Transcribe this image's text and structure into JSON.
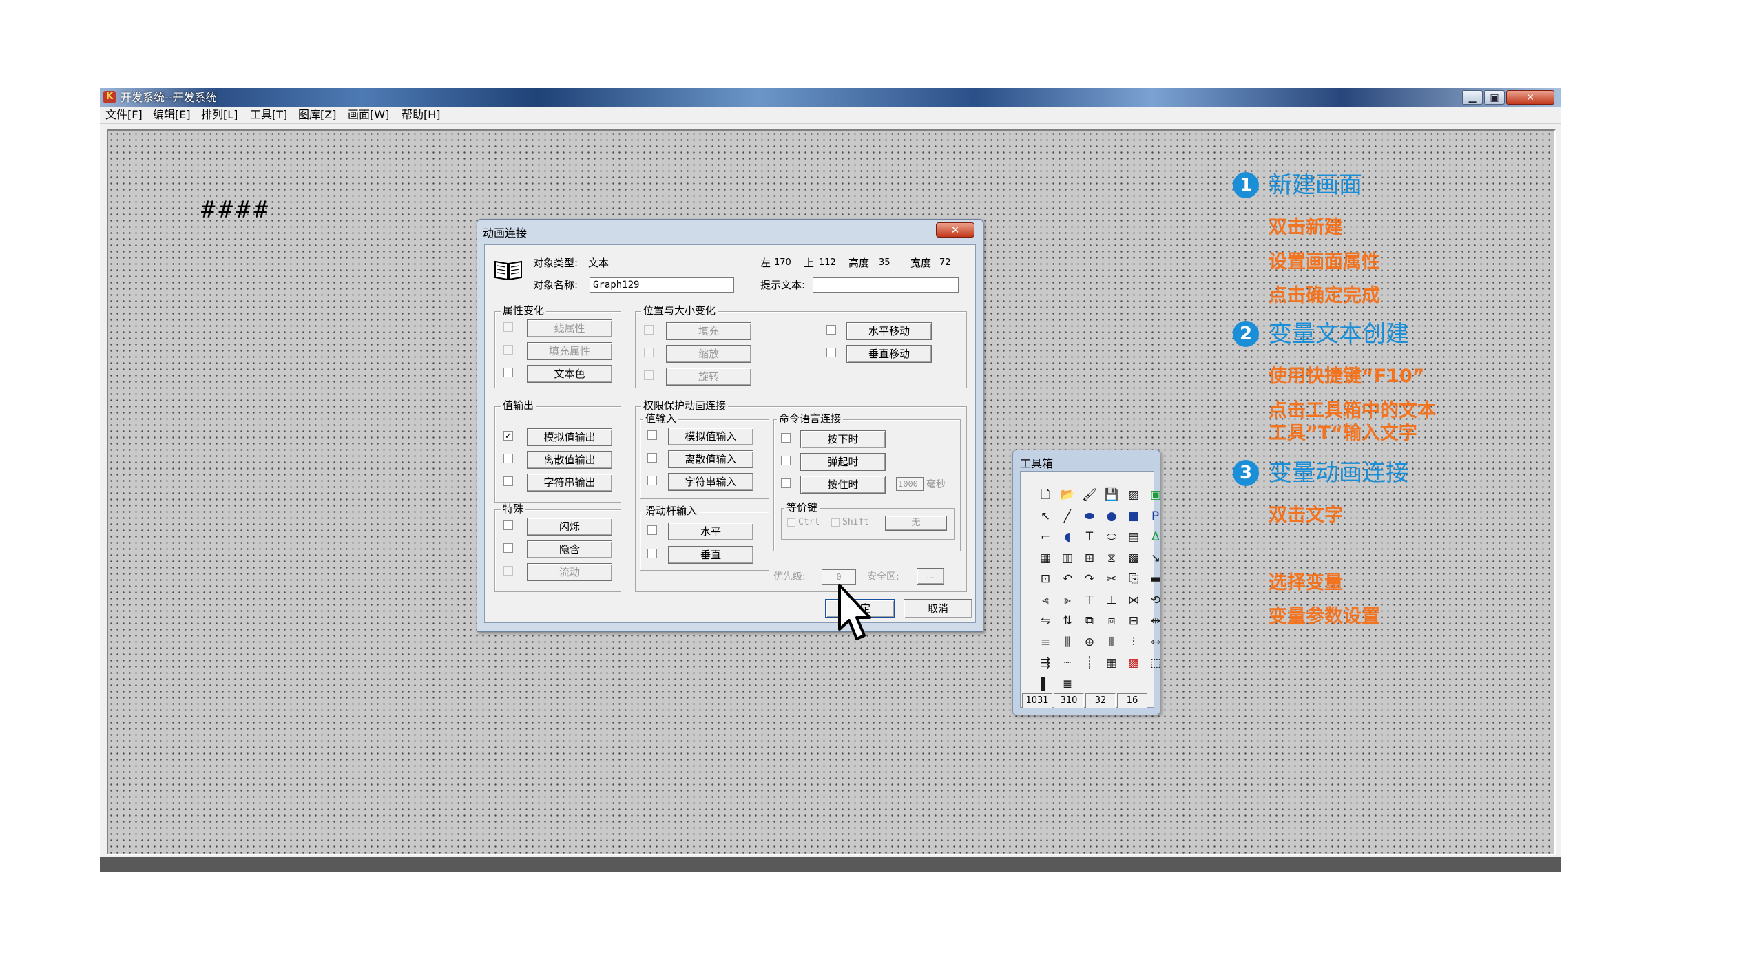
{
  "window": {
    "title": "开发系统--开发系统",
    "minimize": "▁",
    "maximize": "▣",
    "close": "✕"
  },
  "menu": [
    "文件[F]",
    "编辑[E]",
    "排列[L]",
    "工具[T]",
    "图库[Z]",
    "画面[W]",
    "帮助[H]"
  ],
  "canvas": {
    "text": "####"
  },
  "dialog": {
    "title": "动画连接",
    "close": "✕",
    "object_type_label": "对象类型:",
    "object_type_value": "文本",
    "left_label": "左",
    "left_value": "170",
    "top_label": "上",
    "top_value": "112",
    "height_label": "高度",
    "height_value": "35",
    "width_label": "宽度",
    "width_value": "72",
    "object_name_label": "对象名称:",
    "object_name_value": "Graph129",
    "hint_label": "提示文本:",
    "hint_value": "",
    "attr_group": {
      "title": "属性变化",
      "items": [
        "线属性",
        "填充属性",
        "文本色"
      ]
    },
    "pos_group": {
      "title": "位置与大小变化",
      "items": [
        "填充",
        "缩放",
        "旋转"
      ],
      "moves": [
        "水平移动",
        "垂直移动"
      ]
    },
    "value_out_group": {
      "title": "值输出",
      "items": [
        "模拟值输出",
        "离散值输出",
        "字符串输出"
      ],
      "checked": "✓"
    },
    "special_group": {
      "title": "特殊",
      "items": [
        "闪烁",
        "隐含",
        "流动"
      ]
    },
    "perm_group": {
      "title": "权限保护动画连接"
    },
    "value_in_group": {
      "title": "值输入",
      "items": [
        "模拟值输入",
        "离散值输入",
        "字符串输入"
      ]
    },
    "slider_group": {
      "title": "滑动杆输入",
      "items": [
        "水平",
        "垂直"
      ]
    },
    "cmd_group": {
      "title": "命令语言连接",
      "items": [
        "按下时",
        "弹起时",
        "按住时"
      ],
      "interval_value": "1000",
      "interval_unit": "毫秒"
    },
    "hotkey_group": {
      "title": "等价键",
      "ctrl": "Ctrl",
      "shift": "Shift",
      "key_value": "无"
    },
    "priority_label": "优先级:",
    "priority_value": "0",
    "security_label": "安全区:",
    "security_button": "...",
    "ok": "确定",
    "cancel": "取消"
  },
  "toolbox": {
    "title": "工具箱",
    "tools": [
      [
        "new-icon",
        "🗋"
      ],
      [
        "open-icon",
        "📂"
      ],
      [
        "palette-icon",
        "🖌"
      ],
      [
        "save-icon",
        "💾"
      ],
      [
        "picture-icon",
        "▨"
      ],
      [
        "green-frame-icon",
        "▣"
      ],
      [
        "pointer-icon",
        "↖"
      ],
      [
        "line-icon",
        "╱"
      ],
      [
        "ellipse-fill-icon",
        "⬬"
      ],
      [
        "circle-icon",
        "●"
      ],
      [
        "rectangle-icon",
        "■"
      ],
      [
        "polygon-icon",
        "Ꮲ"
      ],
      [
        "polyline-icon",
        "⌐"
      ],
      [
        "arc-icon",
        "◖"
      ],
      [
        "text-icon",
        "T"
      ],
      [
        "rounded-rect-icon",
        "⬭"
      ],
      [
        "bitmap-icon",
        "▤"
      ],
      [
        "fill-icon",
        "ⵠ"
      ],
      [
        "grid-edit-icon",
        "▦"
      ],
      [
        "report-icon",
        "▥"
      ],
      [
        "group-icon",
        "⊞"
      ],
      [
        "chart-icon",
        "⧖"
      ],
      [
        "trend-icon",
        "▩"
      ],
      [
        "link-icon",
        "↘"
      ],
      [
        "window-icon",
        "⊡"
      ],
      [
        "undo-icon",
        "↶"
      ],
      [
        "redo-icon",
        "↷"
      ],
      [
        "cut-icon",
        "✂"
      ],
      [
        "copy-icon",
        "⎘"
      ],
      [
        "paste-icon",
        "▬"
      ],
      [
        "align-left-icon",
        "⫷"
      ],
      [
        "align-right-icon",
        "⫸"
      ],
      [
        "align-top-icon",
        "⊤"
      ],
      [
        "align-bottom-icon",
        "⊥"
      ],
      [
        "align-center-icon",
        "⋈"
      ],
      [
        "rotate-icon",
        "⟲"
      ],
      [
        "flip-h-icon",
        "⇋"
      ],
      [
        "flip-v-icon",
        "⇅"
      ],
      [
        "front-icon",
        "⧉"
      ],
      [
        "back-icon",
        "⧈"
      ],
      [
        "merge-icon",
        "⊟"
      ],
      [
        "space-icon",
        "⇹"
      ],
      [
        "h-space-icon",
        "≡"
      ],
      [
        "v-space-icon",
        "⫼"
      ],
      [
        "center-icon",
        "⊕"
      ],
      [
        "equal-width-icon",
        "⫴"
      ],
      [
        "equal-height-icon",
        "⫶"
      ],
      [
        "distribute-icon",
        "⇿"
      ],
      [
        "arrange-icon",
        "⇶"
      ],
      [
        "dotted-line-icon",
        "┈"
      ],
      [
        "vert-dotted-icon",
        "┊"
      ],
      [
        "grid-icon",
        "▦"
      ],
      [
        "color-grid-icon",
        "▩"
      ],
      [
        "color-select-icon",
        "⬚"
      ],
      [
        "gradient-icon",
        "▌"
      ],
      [
        "lines-icon",
        "≣"
      ]
    ],
    "coords": [
      "1031",
      "310",
      "32",
      "16"
    ]
  },
  "annotations": [
    {
      "num": "1",
      "title": "新建画面",
      "steps": [
        "双击新建",
        "设置画面属性",
        "点击确定完成"
      ]
    },
    {
      "num": "2",
      "title": "变量文本创建",
      "steps": [
        "使用快捷键“F10”",
        "点击工具箱中的文本",
        "工具”T“输入文字"
      ]
    },
    {
      "num": "3",
      "title": "变量动画连接",
      "steps": [
        "双击文字",
        "选择变量",
        "变量参数设置"
      ]
    }
  ],
  "colors": {
    "accent_blue": "#1a8fd8",
    "accent_orange": "#f27421",
    "canvas_gray": "#c9c9c9"
  }
}
